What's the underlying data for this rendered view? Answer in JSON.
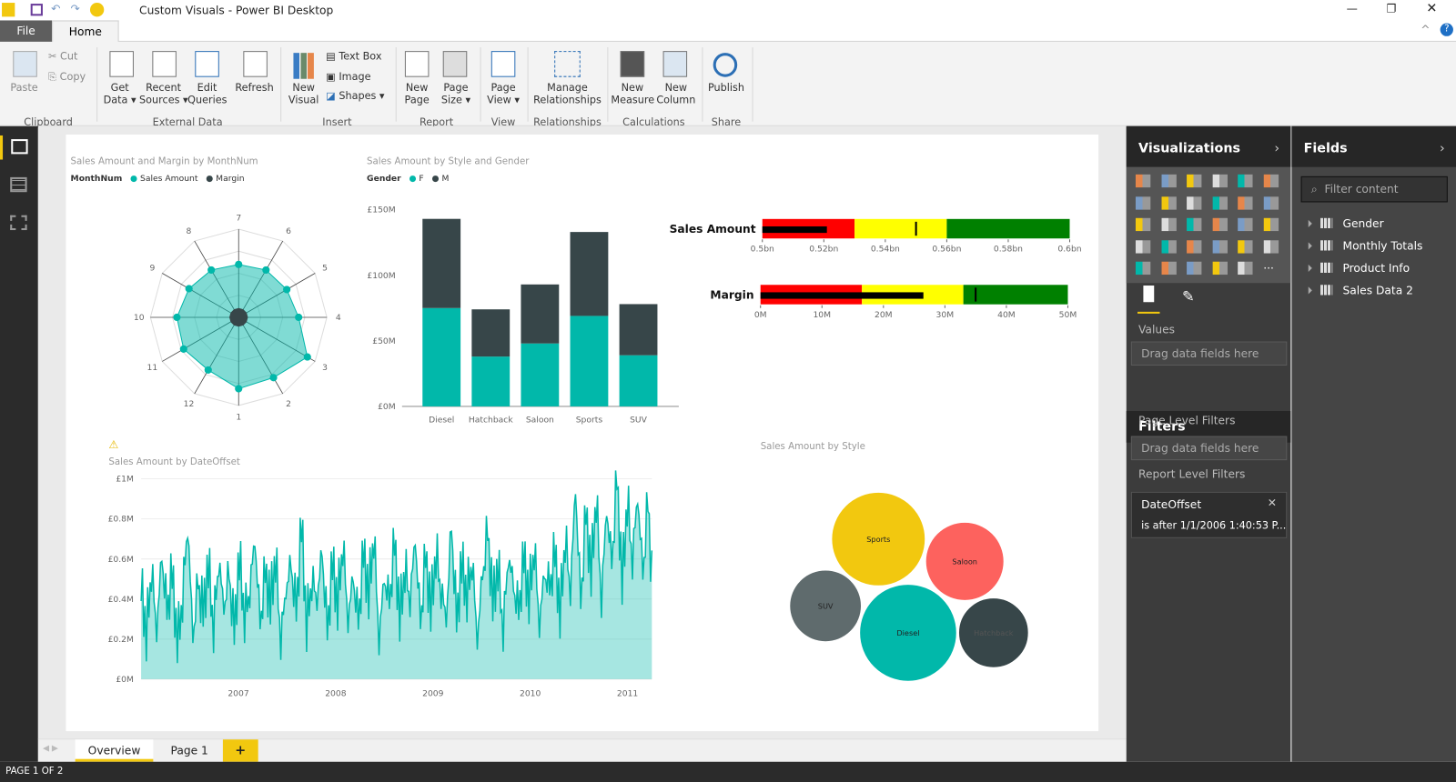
{
  "window": {
    "title": "Custom Visuals - Power BI Desktop"
  },
  "ribbon_tabs": [
    {
      "label": "File"
    },
    {
      "label": "Home"
    }
  ],
  "ribbon": {
    "clipboard": {
      "paste": "Paste",
      "cut": "Cut",
      "copy": "Copy",
      "group": "Clipboard"
    },
    "external": {
      "get_data": "Get\nData ▾",
      "recent": "Recent\nSources ▾",
      "edit": "Edit\nQueries",
      "refresh": "Refresh",
      "group": "External Data"
    },
    "insert": {
      "new_visual": "New\nVisual",
      "text_box": "Text Box",
      "image": "Image",
      "shapes": "Shapes ▾",
      "group": "Insert"
    },
    "report": {
      "new_page": "New\nPage",
      "page_size": "Page\nSize ▾",
      "group": "Report"
    },
    "view": {
      "page_view": "Page\nView ▾",
      "group": "View"
    },
    "relationships": {
      "manage": "Manage\nRelationships",
      "group": "Relationships"
    },
    "calculations": {
      "new_measure": "New\nMeasure",
      "new_column": "New\nColumn",
      "group": "Calculations"
    },
    "share": {
      "publish": "Publish",
      "group": "Share"
    }
  },
  "colors": {
    "teal": "#01B8AA",
    "dark": "#374649",
    "yellow": "#F2C80F",
    "red": "#FD625E",
    "gray": "#5F6B6D",
    "bullet_red": "#FF0000",
    "bullet_yellow": "#FFFF00",
    "bullet_green": "#008000"
  },
  "chart_data": [
    {
      "type": "radar",
      "title": "Sales Amount and Margin by MonthNum",
      "legend_title": "MonthNum",
      "legend_position": "top-left",
      "categories": [
        "7",
        "6",
        "5",
        "4",
        "3",
        "2",
        "1",
        "12",
        "11",
        "10",
        "9",
        "8"
      ],
      "series": [
        {
          "name": "Sales Amount",
          "values": [
            0.6,
            0.62,
            0.63,
            0.68,
            0.9,
            0.79,
            0.81,
            0.69,
            0.72,
            0.7,
            0.65,
            0.62
          ]
        },
        {
          "name": "Margin",
          "values": [
            0.1,
            0.1,
            0.1,
            0.1,
            0.1,
            0.1,
            0.1,
            0.1,
            0.1,
            0.1,
            0.1,
            0.1
          ]
        }
      ]
    },
    {
      "type": "bar",
      "stacked": true,
      "title": "Sales Amount by Style and Gender",
      "legend_title": "Gender",
      "legend_position": "top-left",
      "categories": [
        "Diesel",
        "Hatchback",
        "Saloon",
        "Sports",
        "SUV"
      ],
      "series": [
        {
          "name": "F",
          "values": [
            75,
            38,
            48,
            69,
            39
          ]
        },
        {
          "name": "M",
          "values": [
            68,
            36,
            45,
            64,
            39
          ]
        }
      ],
      "yticks": [
        "£0M",
        "£50M",
        "£100M",
        "£150M"
      ],
      "ylim": [
        0,
        150
      ],
      "yunit": "£M"
    },
    {
      "type": "bullet",
      "label": "Sales Amount",
      "range": [
        0.5,
        0.6
      ],
      "bands": [
        0.53,
        0.56,
        0.6
      ],
      "value": 0.521,
      "target": 0.55,
      "ticks": [
        "0.5bn",
        "0.52bn",
        "0.54bn",
        "0.56bn",
        "0.58bn",
        "0.6bn"
      ]
    },
    {
      "type": "bullet",
      "label": "Margin",
      "range": [
        0,
        50
      ],
      "bands": [
        16.5,
        33,
        50
      ],
      "value": 26.5,
      "target": 35,
      "ticks": [
        "0M",
        "10M",
        "20M",
        "30M",
        "40M",
        "50M"
      ]
    },
    {
      "type": "area",
      "title": "Sales Amount by DateOffset",
      "warning": true,
      "xlim": [
        2006,
        2011.25
      ],
      "ylim": [
        0,
        1
      ],
      "xticks": [
        "2007",
        "2008",
        "2009",
        "2010",
        "2011"
      ],
      "yticks": [
        "£0M",
        "£0.2M",
        "£0.4M",
        "£0.6M",
        "£0.8M",
        "£1M"
      ],
      "values": [
        0.45,
        0.2,
        0.55,
        0.25,
        0.6,
        0.3,
        0.5,
        0.15,
        0.4,
        0.78,
        0.2,
        0.45,
        0.3,
        0.55,
        0.25,
        0.6,
        0.35,
        0.5,
        0.2,
        0.58,
        0.3,
        0.45,
        0.7,
        0.25,
        0.5,
        0.35,
        0.6,
        0.2,
        0.45,
        0.55,
        0.3,
        0.75,
        0.25,
        0.5,
        0.4,
        0.62,
        0.2,
        0.55,
        0.35,
        0.68,
        0.3,
        0.5,
        0.25,
        0.6,
        0.4,
        0.72,
        0.2,
        0.5,
        0.35,
        0.65,
        0.28,
        0.55,
        0.4,
        0.7,
        0.25,
        0.58,
        0.32,
        0.62,
        0.45,
        0.3,
        0.74,
        0.25,
        0.55,
        0.4,
        0.6,
        0.2,
        0.5,
        0.7,
        0.35,
        0.55,
        0.25,
        0.62,
        0.45,
        0.3,
        0.58,
        0.38,
        0.66,
        0.28,
        0.52,
        0.42,
        0.6,
        0.3,
        0.7,
        0.45,
        0.95,
        0.35,
        0.8,
        0.5,
        0.9,
        0.4,
        0.85,
        0.55,
        0.97,
        0.45,
        0.88,
        0.6,
        0.92,
        0.5,
        0.85,
        0.35
      ]
    },
    {
      "type": "bubble",
      "title": "Sales Amount by Style",
      "items": [
        {
          "label": "Sports",
          "value": 133,
          "color": "#F2C80F"
        },
        {
          "label": "Saloon",
          "value": 93,
          "color": "#FD625E"
        },
        {
          "label": "SUV",
          "value": 78,
          "color": "#5F6B6D"
        },
        {
          "label": "Diesel",
          "value": 143,
          "color": "#01B8AA"
        },
        {
          "label": "Hatchback",
          "value": 74,
          "color": "#374649"
        }
      ]
    }
  ],
  "page_tabs": [
    {
      "label": "Overview"
    },
    {
      "label": "Page 1"
    },
    {
      "label": "+"
    }
  ],
  "status": "PAGE 1 OF 2",
  "visualizations": {
    "title": "Visualizations",
    "values_label": "Values",
    "drop_hint": "Drag data fields here"
  },
  "filters": {
    "title": "Filters",
    "page_level": "Page Level Filters",
    "drop_hint": "Drag data fields here",
    "report_level": "Report Level Filters",
    "card_title": "DateOffset",
    "card_value": "is after 1/1/2006 1:40:53 P..."
  },
  "fields": {
    "title": "Fields",
    "placeholder": "Filter content",
    "tables": [
      {
        "label": "Gender"
      },
      {
        "label": "Monthly Totals"
      },
      {
        "label": "Product Info"
      },
      {
        "label": "Sales Data 2"
      }
    ]
  }
}
